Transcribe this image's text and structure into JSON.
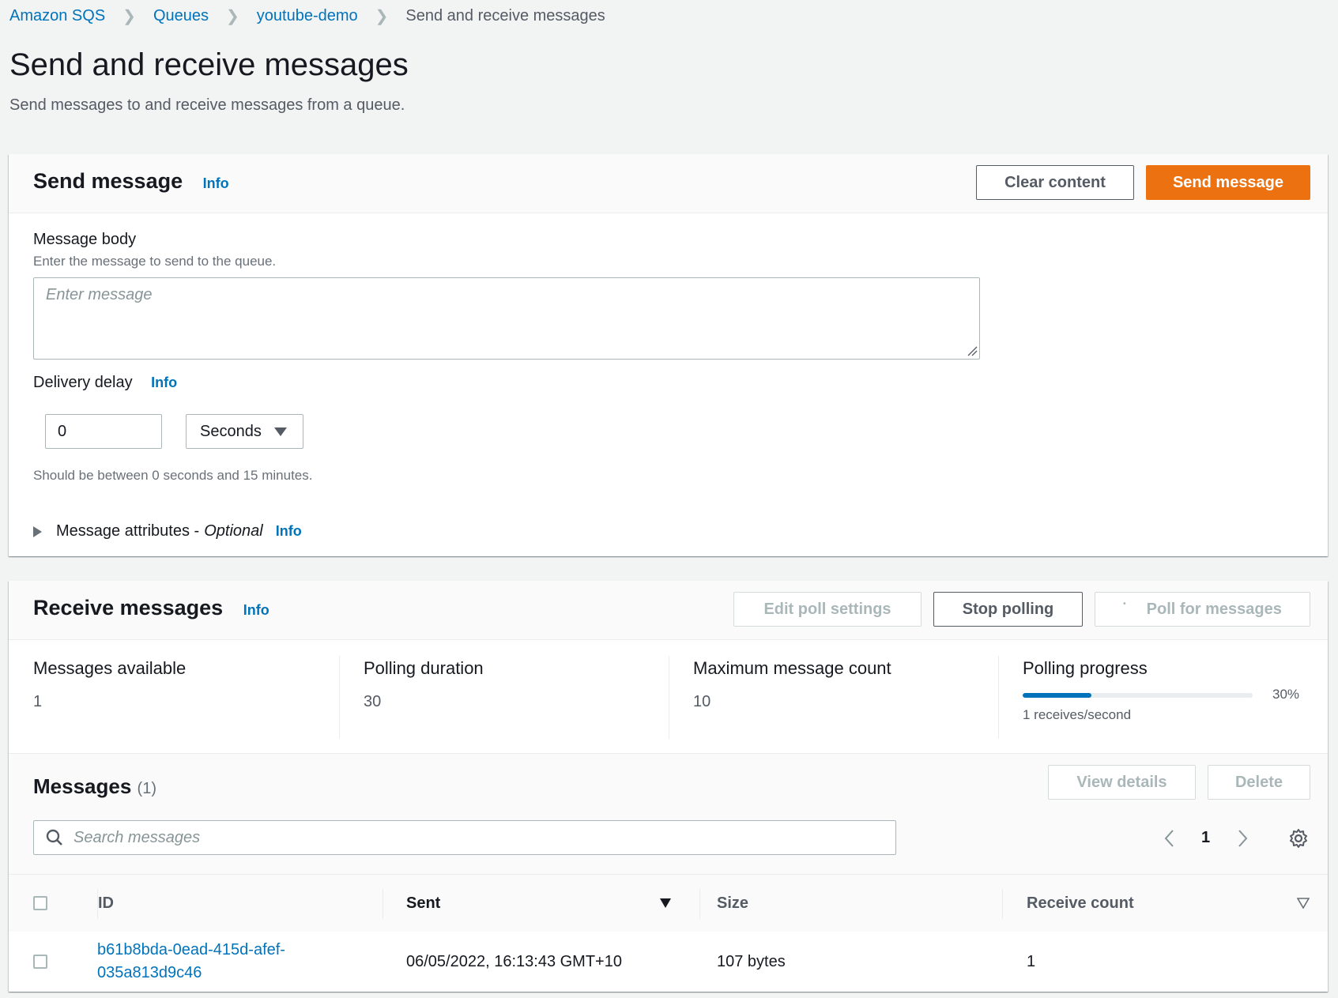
{
  "breadcrumb": {
    "items": [
      {
        "label": "Amazon SQS",
        "link": true
      },
      {
        "label": "Queues",
        "link": true
      },
      {
        "label": "youtube-demo",
        "link": true
      },
      {
        "label": "Send and receive messages",
        "link": false
      }
    ]
  },
  "page": {
    "title": "Send and receive messages",
    "description": "Send messages to and receive messages from a queue."
  },
  "send_panel": {
    "title": "Send message",
    "info": "Info",
    "clear_button": "Clear content",
    "send_button": "Send message",
    "message_body_label": "Message body",
    "message_body_hint": "Enter the message to send to the queue.",
    "message_body_placeholder": "Enter message",
    "message_body_value": "",
    "delivery_delay_label": "Delivery delay",
    "delivery_delay_info": "Info",
    "delivery_delay_value": "0",
    "delivery_delay_unit": "Seconds",
    "delivery_delay_hint": "Should be between 0 seconds and 15 minutes.",
    "attributes_label": "Message attributes -",
    "attributes_optional": "Optional",
    "attributes_info": "Info"
  },
  "receive_panel": {
    "title": "Receive messages",
    "info": "Info",
    "edit_poll_button": "Edit poll settings",
    "stop_polling_button": "Stop polling",
    "poll_button": "Poll for messages",
    "stats": [
      {
        "label": "Messages available",
        "value": "1"
      },
      {
        "label": "Polling duration",
        "value": "30"
      },
      {
        "label": "Maximum message count",
        "value": "10"
      }
    ],
    "polling_progress": {
      "label": "Polling progress",
      "percent": 30,
      "percent_text": "30%",
      "rate": "1 receives/second"
    }
  },
  "messages": {
    "title": "Messages",
    "count": "(1)",
    "view_details_button": "View details",
    "delete_button": "Delete",
    "search_placeholder": "Search messages",
    "page": "1",
    "columns": [
      "ID",
      "Sent",
      "Size",
      "Receive count"
    ],
    "rows": [
      {
        "id_line1": "b61b8bda-0ead-415d-afef-",
        "id_line2": "035a813d9c46",
        "sent": "06/05/2022, 16:13:43 GMT+10",
        "size": "107 bytes",
        "receive_count": "1"
      }
    ]
  },
  "colors": {
    "link": "#0073bb",
    "primary": "#ec7211",
    "progress": "#0073bb"
  }
}
